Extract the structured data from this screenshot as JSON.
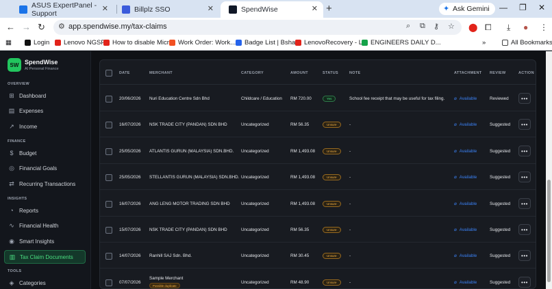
{
  "browser": {
    "tabs": [
      {
        "title": "ASUS ExpertPanel - Support",
        "active": false,
        "favicon_color": "#1a73e8"
      },
      {
        "title": "Billplz SSO",
        "active": false,
        "favicon_color": "#3b5bdb"
      },
      {
        "title": "SpendWise",
        "active": true,
        "favicon_color": "#111827"
      }
    ],
    "gemini_label": "Ask Gemini",
    "url": "app.spendwise.my/tax-claims",
    "bookmarks": [
      {
        "label": "Login",
        "color": "#111111"
      },
      {
        "label": "Lenovo NGSP",
        "color": "#e2231a"
      },
      {
        "label": "How to disable Micr...",
        "color": "#e2231a"
      },
      {
        "label": "Work Order: Work...",
        "color": "#f25022"
      },
      {
        "label": "Badge List | Bsharp",
        "color": "#2563eb"
      },
      {
        "label": "LenovoRecovery - L...",
        "color": "#e2231a"
      },
      {
        "label": "ENGINEERS DAILY D...",
        "color": "#16a34a"
      }
    ],
    "all_bookmarks": "All Bookmarks"
  },
  "sidebar": {
    "brand_mark": "SW",
    "brand_name": "SpendWise",
    "brand_subtitle": "AI Personal Finance",
    "sections": {
      "overview": "OVERVIEW",
      "finance": "FINANCE",
      "insights": "INSIGHTS",
      "tools": "TOOLS"
    },
    "items": [
      {
        "label": "Dashboard",
        "icon": "grid-icon"
      },
      {
        "label": "Expenses",
        "icon": "receipt-icon"
      },
      {
        "label": "Income",
        "icon": "trend-up-icon"
      },
      {
        "label": "Budget",
        "icon": "dollar-icon"
      },
      {
        "label": "Financial Goals",
        "icon": "target-icon"
      },
      {
        "label": "Recurring Transactions",
        "icon": "repeat-icon"
      },
      {
        "label": "Reports",
        "icon": "pie-icon"
      },
      {
        "label": "Financial Health",
        "icon": "pulse-icon"
      },
      {
        "label": "Smart Insights",
        "icon": "bulb-icon"
      },
      {
        "label": "Tax Claim Documents",
        "icon": "document-icon",
        "active": true
      },
      {
        "label": "Categories",
        "icon": "tag-icon"
      }
    ]
  },
  "table": {
    "headers": {
      "date": "DATE",
      "merchant": "MERCHANT",
      "category": "CATEGORY",
      "amount": "AMOUNT",
      "status": "STATUS",
      "note": "NOTE",
      "attachment": "ATTACHMENT",
      "review": "REVIEW",
      "action": "ACTION"
    },
    "rows": [
      {
        "date": "20/06/2026",
        "merchant": "Nuri Education Centre Sdn Bhd",
        "category": "Childcare / Education",
        "amount": "RM 720.00",
        "status": "Yes",
        "note": "School fee receipt that may be useful for tax filing.",
        "attachment": "Available",
        "review": "Reviewed"
      },
      {
        "date": "16/07/2026",
        "merchant": "NSK TRADE CITY (PANDAN) SDN BHD",
        "category": "Uncategorized",
        "amount": "RM 56.35",
        "status": "Unsure",
        "note": "-",
        "attachment": "Available",
        "review": "Suggested"
      },
      {
        "date": "25/05/2026",
        "merchant": "ATLANTIS GURUN (MALAYSIA) SDN.BHD.",
        "category": "Uncategorized",
        "amount": "RM 1,493.08",
        "status": "Unsure",
        "note": "-",
        "attachment": "Available",
        "review": "Suggested"
      },
      {
        "date": "25/05/2026",
        "merchant": "STELLANTIS GURUN (MALAYSIA) SDN.BHD.",
        "category": "Uncategorized",
        "amount": "RM 1,493.08",
        "status": "Unsure",
        "note": "-",
        "attachment": "Available",
        "review": "Suggested"
      },
      {
        "date": "16/07/2026",
        "merchant": "ANG LENG MOTOR TRADING SDN BHD",
        "category": "Uncategorized",
        "amount": "RM 1,493.08",
        "status": "Unsure",
        "note": "-",
        "attachment": "Available",
        "review": "Suggested"
      },
      {
        "date": "15/07/2026",
        "merchant": "NSK TRADE CITY (PANDAN) SDN BHD",
        "category": "Uncategorized",
        "amount": "RM 56.35",
        "status": "Unsure",
        "note": "-",
        "attachment": "Available",
        "review": "Suggested"
      },
      {
        "date": "14/07/2026",
        "merchant": "Ranhill SAJ Sdn. Bhd.",
        "category": "Uncategorized",
        "amount": "RM 30.45",
        "status": "Unsure",
        "note": "-",
        "attachment": "Available",
        "review": "Suggested"
      },
      {
        "date": "07/07/2026",
        "merchant": "Sample Merchant",
        "merchant_flag": "Possible duplicate",
        "category": "Uncategorized",
        "amount": "RM 48.90",
        "status": "Unsure",
        "note": "-",
        "attachment": "Available",
        "review": "Suggested"
      }
    ],
    "action_label": "•••"
  },
  "colors": {
    "accent": "#22c55e",
    "link": "#3b82f6",
    "unsure": "#f5b042",
    "background": "#0f1115"
  }
}
